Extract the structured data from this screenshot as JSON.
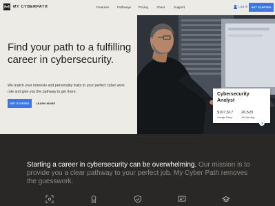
{
  "brand": {
    "name": "MY CYBERPATH"
  },
  "nav": {
    "items": [
      "Features",
      "Pathways",
      "Pricing",
      "About",
      "Support"
    ],
    "login_label": "Log In",
    "cta_label": "GET STARTED"
  },
  "hero": {
    "title": "Find your path to a fulfilling career in cybersecurity.",
    "description": "We match your interests and personality traits to your perfect cyber work role and give you the pathway to get there.",
    "primary_button": "GET STARTED",
    "secondary_link": "LEARN MORE"
  },
  "career_card": {
    "title": "Cybersecurity Analyst",
    "stats": [
      {
        "value": "$107,517",
        "label": "Average Salary"
      },
      {
        "value": "26,529",
        "label": "Job Openings"
      }
    ]
  },
  "mission": {
    "lead": "Starting a career in cybersecurity can be overwhelming.",
    "rest": " Our mission is to provide you a clear pathway to your perfect job. My Cyber Path removes the guesswork."
  },
  "feature_icons": [
    "scan-face-icon",
    "award-icon",
    "shield-check-icon",
    "certificate-icon",
    "graduation-cap-icon"
  ],
  "colors": {
    "accent": "#3b78e7",
    "background": "#ecebe6",
    "dark": "#2a2826",
    "muted_text": "#8f8c86"
  }
}
